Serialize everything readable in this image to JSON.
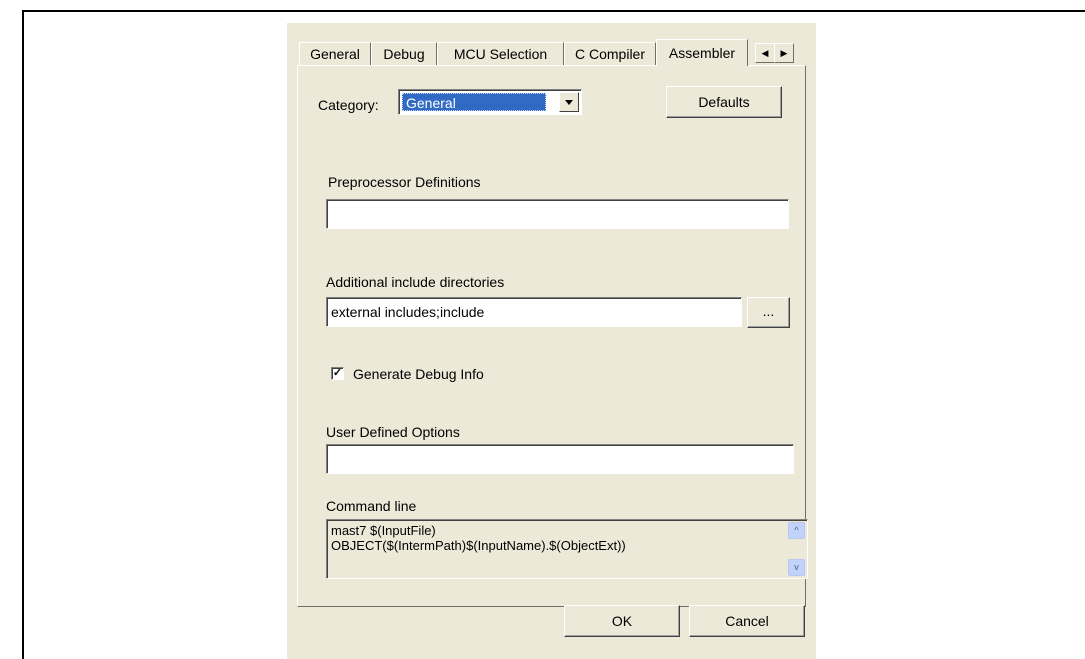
{
  "tabs": [
    {
      "label": "General"
    },
    {
      "label": "Debug"
    },
    {
      "label": "MCU Selection"
    },
    {
      "label": "C Compiler"
    },
    {
      "label": "Assembler"
    }
  ],
  "tab_scroll": {
    "left_glyph": "◀",
    "right_glyph": "▶"
  },
  "category": {
    "label": "Category:",
    "value": "General"
  },
  "defaults_label": "Defaults",
  "preprocessor": {
    "label": "Preprocessor Definitions",
    "value": ""
  },
  "include_dirs": {
    "label": "Additional include directories",
    "value": "external includes;include",
    "browse_label": "..."
  },
  "debug_info": {
    "label": "Generate Debug Info",
    "checked_glyph": "✓"
  },
  "user_options": {
    "label": "User Defined Options",
    "value": ""
  },
  "command_line": {
    "label": "Command line",
    "line1": "mast7 $(InputFile)",
    "line2": "OBJECT($(IntermPath)$(InputName).$(ObjectExt))"
  },
  "ok_label": "OK",
  "cancel_label": "Cancel",
  "icons": {
    "scroll_up": "^",
    "scroll_down": "v"
  }
}
